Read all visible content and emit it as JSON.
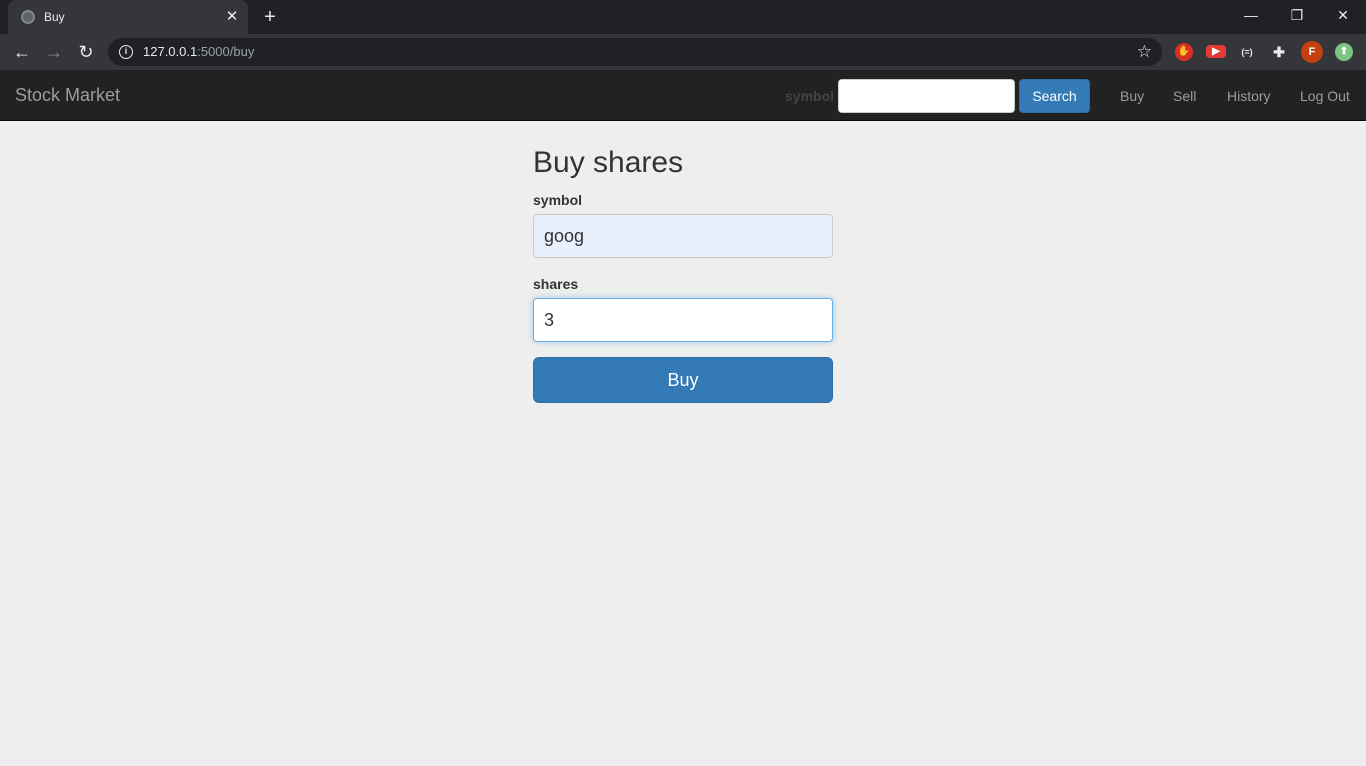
{
  "browser": {
    "tab_title": "Buy",
    "url_host": "127.0.0.1",
    "url_path": ":5000/buy",
    "profile_initial": "F"
  },
  "navbar": {
    "brand": "Stock Market",
    "search_label": "symbol",
    "search_value": "",
    "search_button": "Search",
    "links": [
      "Buy",
      "Sell",
      "History",
      "Log Out"
    ]
  },
  "form": {
    "title": "Buy shares",
    "symbol_label": "symbol",
    "symbol_value": "goog",
    "shares_label": "shares",
    "shares_value": "3",
    "submit_label": "Buy"
  },
  "colors": {
    "navbar_bg": "#222222",
    "primary": "#337ab7",
    "page_bg": "#eeeeee",
    "autofill_bg": "#e8f0fe"
  }
}
